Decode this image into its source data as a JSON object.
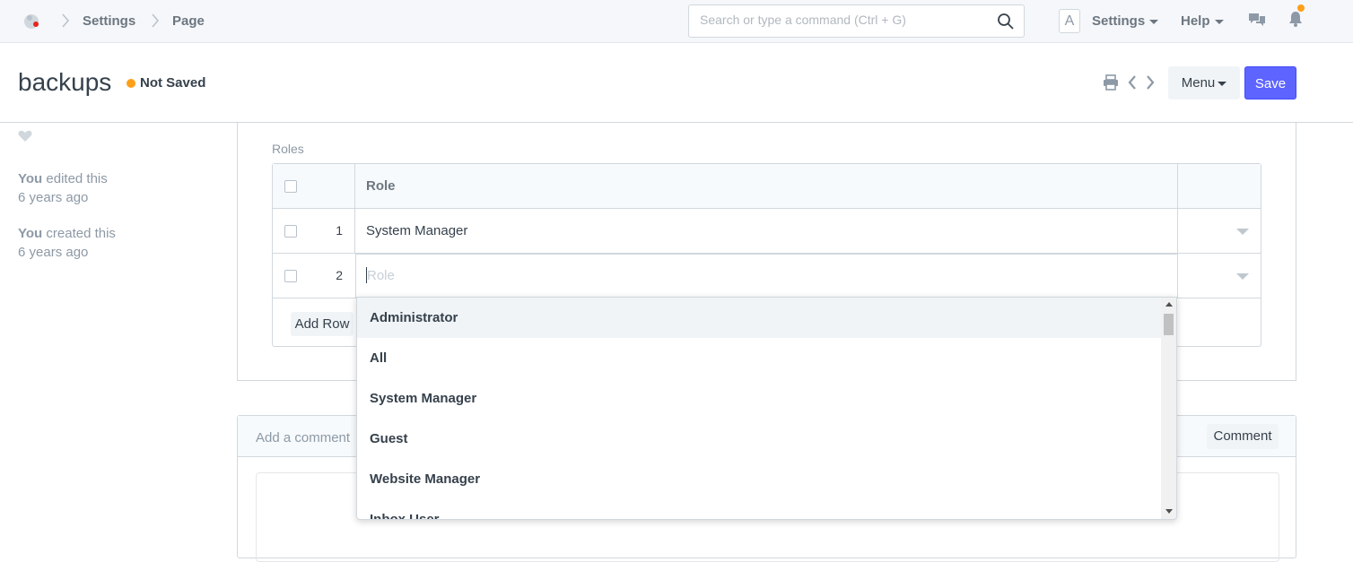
{
  "navbar": {
    "breadcrumbs": [
      "Settings",
      "Page"
    ],
    "search_placeholder": "Search or type a command (Ctrl + G)",
    "avatar_letter": "A",
    "settings_label": "Settings",
    "help_label": "Help"
  },
  "page": {
    "title": "backups",
    "status": "Not Saved",
    "menu_label": "Menu",
    "save_label": "Save"
  },
  "sidebar": {
    "timeline": [
      {
        "actor": "You",
        "action": " edited this",
        "time": "6 years ago"
      },
      {
        "actor": "You",
        "action": " created this",
        "time": "6 years ago"
      }
    ]
  },
  "roles": {
    "label": "Roles",
    "column_header": "Role",
    "rows": [
      {
        "idx": "1",
        "value": "System Manager"
      },
      {
        "idx": "2",
        "placeholder": "Role"
      }
    ],
    "add_row_label": "Add Row"
  },
  "dropdown": {
    "options": [
      "Administrator",
      "All",
      "System Manager",
      "Guest",
      "Website Manager",
      "Inbox User"
    ],
    "active_index": 0
  },
  "comment": {
    "placeholder": "Add a comment",
    "button_label": "Comment"
  },
  "colors": {
    "primary": "#5e64ff",
    "indicator_orange": "#ff9f1a"
  },
  "icons": [
    "app-logo-icon",
    "search-icon",
    "chat-icon",
    "bell-icon",
    "print-icon",
    "prev-icon",
    "next-icon",
    "heart-icon"
  ]
}
